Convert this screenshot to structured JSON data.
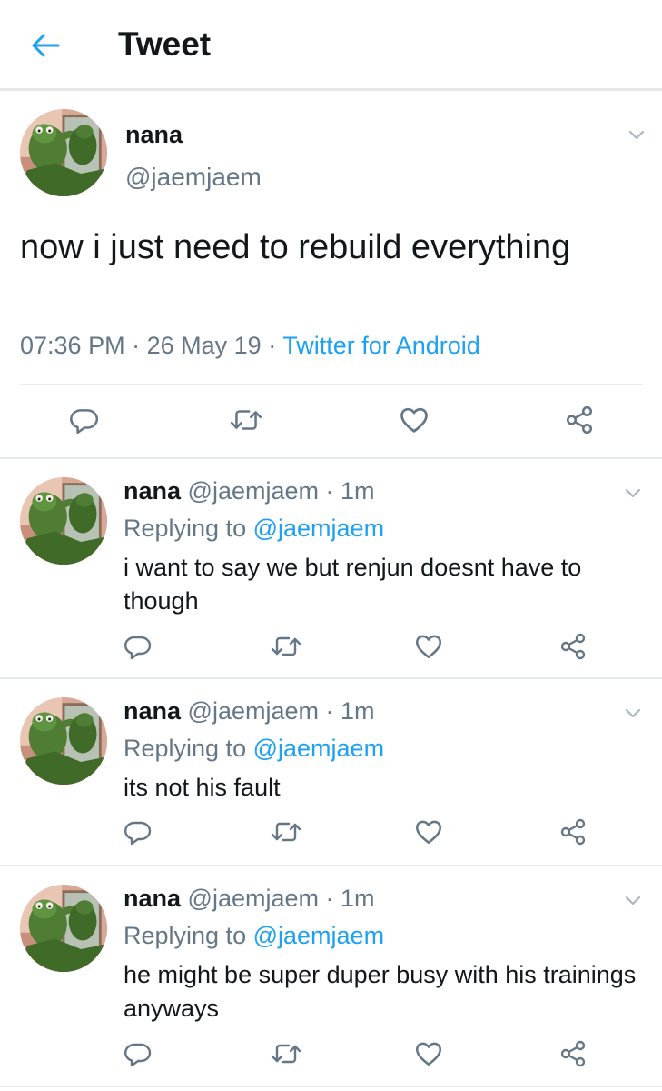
{
  "header": {
    "title": "Tweet"
  },
  "main_tweet": {
    "name": "nana",
    "handle": "@jaemjaem",
    "text": "now i just need to rebuild everything",
    "time": "07:36 PM",
    "date": "26 May 19",
    "separator": "·",
    "source": "Twitter for Android"
  },
  "replies": [
    {
      "name": "nana",
      "handle": "@jaemjaem",
      "time": "1m",
      "replying_label": "Replying to",
      "replying_to": "@jaemjaem",
      "text": "i want to say we but renjun doesnt have to though"
    },
    {
      "name": "nana",
      "handle": "@jaemjaem",
      "time": "1m",
      "replying_label": "Replying to",
      "replying_to": "@jaemjaem",
      "text": "its not his fault"
    },
    {
      "name": "nana",
      "handle": "@jaemjaem",
      "time": "1m",
      "replying_label": "Replying to",
      "replying_to": "@jaemjaem",
      "text": "he might be super duper busy with his trainings anyways"
    }
  ],
  "icons": {
    "back": "arrow-left-icon",
    "caret": "chevron-down-icon",
    "reply": "reply-bubble-icon",
    "retweet": "retweet-icon",
    "like": "heart-icon",
    "share": "share-icon"
  },
  "colors": {
    "accent": "#1da1f2",
    "secondary_text": "#657786",
    "icon_gray": "#657786",
    "divider": "#e6ecf0"
  }
}
